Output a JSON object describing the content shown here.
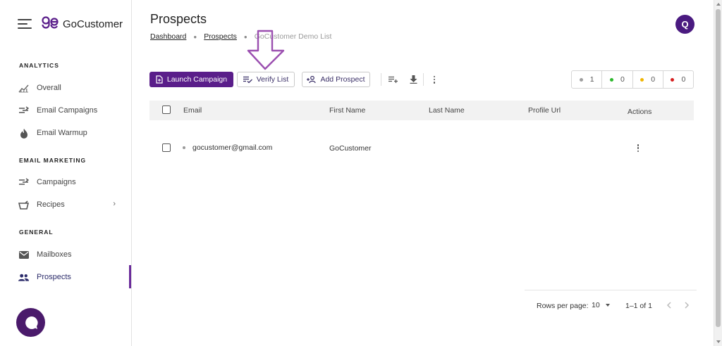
{
  "app": {
    "name": "GoCustomer"
  },
  "sidebar": {
    "sections": [
      {
        "title": "ANALYTICS",
        "items": [
          {
            "label": "Overall",
            "icon": "chart-icon"
          },
          {
            "label": "Email Campaigns",
            "icon": "campaigns-icon"
          },
          {
            "label": "Email Warmup",
            "icon": "flame-icon"
          }
        ]
      },
      {
        "title": "EMAIL MARKETING",
        "items": [
          {
            "label": "Campaigns",
            "icon": "campaigns-icon"
          },
          {
            "label": "Recipes",
            "icon": "basket-icon"
          }
        ]
      },
      {
        "title": "GENERAL",
        "items": [
          {
            "label": "Mailboxes",
            "icon": "mail-icon"
          },
          {
            "label": "Prospects",
            "icon": "people-icon",
            "active": true
          }
        ]
      }
    ]
  },
  "header": {
    "title": "Prospects",
    "breadcrumb": [
      "Dashboard",
      "Prospects",
      "GoCustomer Demo List"
    ],
    "avatar_initial": "Q"
  },
  "toolbar": {
    "launch_label": "Launch Campaign",
    "verify_label": "Verify List",
    "add_label": "Add Prospect"
  },
  "stats": [
    {
      "count": "1",
      "color": "#9e9e9e"
    },
    {
      "count": "0",
      "color": "#2db82d"
    },
    {
      "count": "0",
      "color": "#f0b400"
    },
    {
      "count": "0",
      "color": "#d61f1f"
    }
  ],
  "table": {
    "columns": [
      "Email",
      "First Name",
      "Last Name",
      "Profile Url",
      "Actions"
    ],
    "rows": [
      {
        "email": "gocustomer@gmail.com",
        "first_name": "GoCustomer",
        "last_name": "",
        "profile_url": ""
      }
    ]
  },
  "pagination": {
    "rows_per_page_label": "Rows per page:",
    "rows_per_page": "10",
    "range": "1–1 of 1"
  },
  "colors": {
    "brand": "#5a1e8a",
    "avatar": "#4a1a80",
    "chat": "#4a1a6b"
  }
}
